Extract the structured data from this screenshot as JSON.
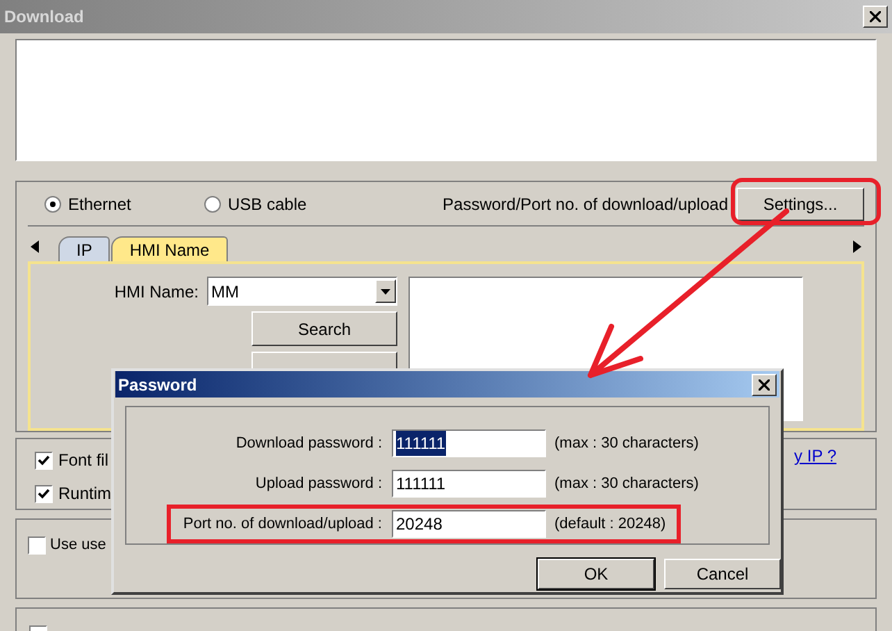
{
  "window": {
    "title": "Download"
  },
  "connection": [
    {
      "label": "Ethernet",
      "selected": true
    },
    {
      "label": "USB cable",
      "selected": false
    }
  ],
  "settings_label": "Password/Port no. of download/upload",
  "settings_button": {
    "label": "Settings...",
    "highlighted": true
  },
  "tabs": [
    {
      "label": "IP",
      "selected": false
    },
    {
      "label": "HMI Name",
      "selected": true
    }
  ],
  "hmi_name": {
    "label": "HMI Name:",
    "value": "MM"
  },
  "search_buttons": [
    "Search"
  ],
  "options": [
    {
      "label": "Font fil",
      "checked": true
    },
    {
      "label": "Runtim",
      "checked": true
    }
  ],
  "link": "y IP ?",
  "user_option": {
    "label": "Use use",
    "checked": false
  },
  "password_dialog": {
    "title": "Password",
    "rows": [
      {
        "label": "Download password :",
        "value": "111111",
        "selected": true,
        "hint": "(max : 30 characters)",
        "highlighted": false
      },
      {
        "label": "Upload password :",
        "value": "111111",
        "selected": false,
        "hint": "(max : 30 characters)",
        "highlighted": false
      },
      {
        "label": "Port no. of download/upload :",
        "value": "20248",
        "selected": false,
        "hint": "(default : 20248)",
        "highlighted": true
      }
    ],
    "buttons": [
      {
        "label": "OK",
        "default": true
      },
      {
        "label": "Cancel",
        "default": false
      }
    ]
  }
}
